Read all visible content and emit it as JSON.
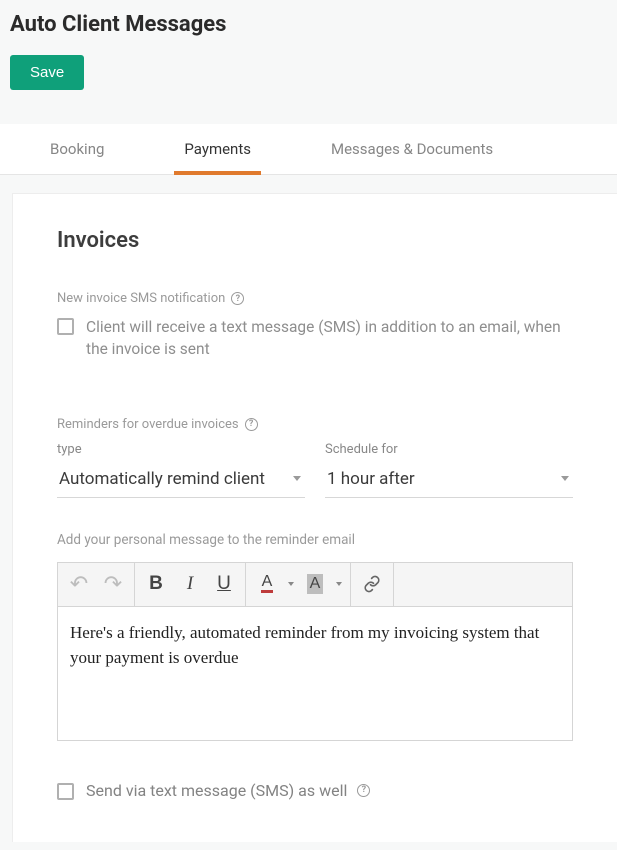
{
  "header": {
    "title": "Auto Client Messages",
    "save_label": "Save"
  },
  "tabs": {
    "booking": "Booking",
    "payments": "Payments",
    "messages_docs": "Messages & Documents"
  },
  "invoices": {
    "section_title": "Invoices",
    "new_invoice_sms": {
      "label": "New invoice SMS notification",
      "checkbox_text": "Client will receive a text message (SMS) in addition to an email, when the invoice is sent"
    },
    "reminders": {
      "label": "Reminders for overdue invoices",
      "type_label": "type",
      "type_value": "Automatically remind client",
      "schedule_label": "Schedule for",
      "schedule_value": "1 hour after"
    },
    "editor": {
      "label": "Add your personal message to the reminder email",
      "content": "Here's a friendly, automated reminder from my invoicing system that your payment is overdue"
    },
    "send_sms": {
      "label": "Send via text message (SMS) as well"
    }
  }
}
